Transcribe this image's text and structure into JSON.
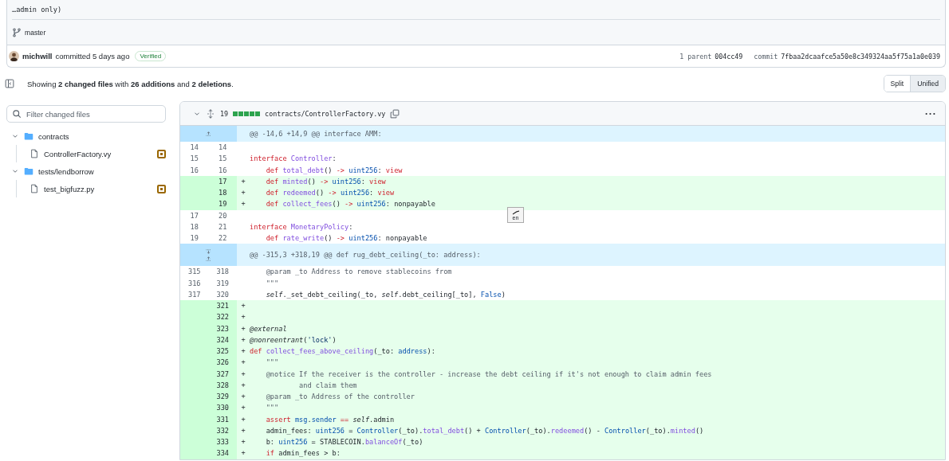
{
  "commit": {
    "message_tail": "…admin only)",
    "branch": "master",
    "author": "michwill",
    "action": "committed 5 days ago",
    "badge": "Verified",
    "parent_label": "1 parent",
    "parent": "004cc49",
    "commit_label": "commit",
    "hash": "7fbaa2dcaafce5a50e8c349324aa5f75a1a0e039"
  },
  "summary": {
    "text": "Showing **2 changed files** with **26 additions** and **2 deletions**."
  },
  "view_toggle": [
    {
      "label": "Split",
      "selected": false
    },
    {
      "label": "Unified",
      "selected": true
    }
  ],
  "filter": {
    "placeholder": "Filter changed files"
  },
  "tree": [
    {
      "name": "contracts",
      "expanded": true,
      "children": [
        {
          "name": "ControllerFactory.vy",
          "color": "#9a6700"
        }
      ]
    },
    {
      "name": "tests/lendborrow",
      "expanded": true,
      "children": [
        {
          "name": "test_bigfuzz.py",
          "color": "#9a6700"
        }
      ]
    }
  ],
  "file": {
    "expanded": true,
    "count": "19",
    "diffstat": {
      "level": 1
    },
    "path": "contracts/ControllerFactory.vy",
    "rows": [
      {
        "kind": "hunk",
        "expand_up": true,
        "expand_down": false,
        "text": "@@ -14,6 +14,9 @@ interface AMM:"
      },
      {
        "kind": "context",
        "old": "14",
        "new": "14",
        "code": []
      },
      {
        "kind": "context",
        "old": "15",
        "new": "15",
        "code": [
          {
            "kind": "kw",
            "t": "interface "
          },
          {
            "kind": "fn",
            "t": "Controller"
          },
          {
            "kind": "p",
            "t": ":"
          }
        ]
      },
      {
        "kind": "context",
        "old": "16",
        "new": "16",
        "code": [
          {
            "kind": "kw",
            "t": "    def "
          },
          {
            "kind": "fn",
            "t": "total_debt"
          },
          {
            "kind": "p",
            "t": "() "
          },
          {
            "kind": "kw",
            "t": "-> "
          },
          {
            "kind": "ty",
            "t": "uint256"
          },
          {
            "kind": "p",
            "t": ": "
          },
          {
            "kind": "kw",
            "t": "view"
          }
        ]
      },
      {
        "kind": "add",
        "new": "17",
        "sign": "+",
        "code": [
          {
            "kind": "kw",
            "t": "    def "
          },
          {
            "kind": "fn",
            "t": "minted"
          },
          {
            "kind": "p",
            "t": "() "
          },
          {
            "kind": "kw",
            "t": "-> "
          },
          {
            "kind": "ty",
            "t": "uint256"
          },
          {
            "kind": "p",
            "t": ": "
          },
          {
            "kind": "kw",
            "t": "view"
          }
        ]
      },
      {
        "kind": "add",
        "new": "18",
        "sign": "+",
        "code": [
          {
            "kind": "kw",
            "t": "    def "
          },
          {
            "kind": "fn",
            "t": "redeemed"
          },
          {
            "kind": "p",
            "t": "() "
          },
          {
            "kind": "kw",
            "t": "-> "
          },
          {
            "kind": "ty",
            "t": "uint256"
          },
          {
            "kind": "p",
            "t": ": "
          },
          {
            "kind": "kw",
            "t": "view"
          }
        ]
      },
      {
        "kind": "add",
        "new": "19",
        "sign": "+",
        "code": [
          {
            "kind": "kw",
            "t": "    def "
          },
          {
            "kind": "fn",
            "t": "collect_fees"
          },
          {
            "kind": "p",
            "t": "() "
          },
          {
            "kind": "kw",
            "t": "-> "
          },
          {
            "kind": "ty",
            "t": "uint256"
          },
          {
            "kind": "p",
            "t": ": nonpayable"
          }
        ]
      },
      {
        "kind": "context",
        "old": "17",
        "new": "20",
        "code": []
      },
      {
        "kind": "context",
        "old": "18",
        "new": "21",
        "code": [
          {
            "kind": "kw",
            "t": "interface "
          },
          {
            "kind": "fn",
            "t": "MonetaryPolicy"
          },
          {
            "kind": "p",
            "t": ":"
          }
        ]
      },
      {
        "kind": "context",
        "old": "19",
        "new": "22",
        "code": [
          {
            "kind": "kw",
            "t": "    def "
          },
          {
            "kind": "fn",
            "t": "rate_write"
          },
          {
            "kind": "p",
            "t": "() "
          },
          {
            "kind": "kw",
            "t": "-> "
          },
          {
            "kind": "ty",
            "t": "uint256"
          },
          {
            "kind": "p",
            "t": ": nonpayable"
          }
        ]
      },
      {
        "kind": "hunk",
        "expand_up": true,
        "expand_down": true,
        "text": "@@ -315,3 +318,19 @@ def rug_debt_ceiling(_to: address):"
      },
      {
        "kind": "context",
        "old": "315",
        "new": "318",
        "code": [
          {
            "kind": "cm",
            "t": "    @param _to Address to remove stablecoins from"
          }
        ]
      },
      {
        "kind": "context",
        "old": "316",
        "new": "319",
        "code": [
          {
            "kind": "cm",
            "t": "    \"\"\""
          }
        ]
      },
      {
        "kind": "context",
        "old": "317",
        "new": "320",
        "code": [
          {
            "kind": "it",
            "t": "    self"
          },
          {
            "kind": "p",
            "t": "._set_debt_ceiling(_to, "
          },
          {
            "kind": "it",
            "t": "self"
          },
          {
            "kind": "p",
            "t": ".debt_ceiling[_to], "
          },
          {
            "kind": "ty",
            "t": "False"
          },
          {
            "kind": "p",
            "t": ")"
          }
        ]
      },
      {
        "kind": "add",
        "new": "321",
        "sign": "+",
        "code": []
      },
      {
        "kind": "add",
        "new": "322",
        "sign": "+",
        "code": []
      },
      {
        "kind": "add",
        "new": "323",
        "sign": "+",
        "code": [
          {
            "kind": "it",
            "t": "@external"
          }
        ]
      },
      {
        "kind": "add",
        "new": "324",
        "sign": "+",
        "code": [
          {
            "kind": "it",
            "t": "@nonreentrant"
          },
          {
            "kind": "p",
            "t": "("
          },
          {
            "kind": "st",
            "t": "'lock'"
          },
          {
            "kind": "p",
            "t": ")"
          }
        ]
      },
      {
        "kind": "add",
        "new": "325",
        "sign": "+",
        "code": [
          {
            "kind": "kw",
            "t": "def "
          },
          {
            "kind": "fn",
            "t": "collect_fees_above_ceiling"
          },
          {
            "kind": "p",
            "t": "(_to: "
          },
          {
            "kind": "ty",
            "t": "address"
          },
          {
            "kind": "p",
            "t": "):"
          }
        ]
      },
      {
        "kind": "add",
        "new": "326",
        "sign": "+",
        "code": [
          {
            "kind": "cm",
            "t": "    \"\"\""
          }
        ]
      },
      {
        "kind": "add",
        "new": "327",
        "sign": "+",
        "code": [
          {
            "kind": "cm",
            "t": "    @notice If the receiver is the controller - increase the debt ceiling if it's not enough to claim admin fees"
          }
        ]
      },
      {
        "kind": "add",
        "new": "328",
        "sign": "+",
        "code": [
          {
            "kind": "cm",
            "t": "            and claim them"
          }
        ]
      },
      {
        "kind": "add",
        "new": "329",
        "sign": "+",
        "code": [
          {
            "kind": "cm",
            "t": "    @param _to Address of the controller"
          }
        ]
      },
      {
        "kind": "add",
        "new": "330",
        "sign": "+",
        "code": [
          {
            "kind": "cm",
            "t": "    \"\"\""
          }
        ]
      },
      {
        "kind": "add",
        "new": "331",
        "sign": "+",
        "code": [
          {
            "kind": "kw",
            "t": "    assert "
          },
          {
            "kind": "ty",
            "t": "msg"
          },
          {
            "kind": "p",
            "t": "."
          },
          {
            "kind": "ty",
            "t": "sender "
          },
          {
            "kind": "kw",
            "t": "== "
          },
          {
            "kind": "it",
            "t": "self"
          },
          {
            "kind": "p",
            "t": ".admin"
          }
        ]
      },
      {
        "kind": "add",
        "new": "332",
        "sign": "+",
        "code": [
          {
            "kind": "p",
            "t": "    admin_fees: "
          },
          {
            "kind": "ty",
            "t": "uint256"
          },
          {
            "kind": "p",
            "t": " = "
          },
          {
            "kind": "ty",
            "t": "Controller"
          },
          {
            "kind": "p",
            "t": "(_to)."
          },
          {
            "kind": "fn",
            "t": "total_debt"
          },
          {
            "kind": "p",
            "t": "() + "
          },
          {
            "kind": "ty",
            "t": "Controller"
          },
          {
            "kind": "p",
            "t": "(_to)."
          },
          {
            "kind": "fn",
            "t": "redeemed"
          },
          {
            "kind": "p",
            "t": "() - "
          },
          {
            "kind": "ty",
            "t": "Controller"
          },
          {
            "kind": "p",
            "t": "(_to)."
          },
          {
            "kind": "fn",
            "t": "minted"
          },
          {
            "kind": "p",
            "t": "()"
          }
        ]
      },
      {
        "kind": "add",
        "new": "333",
        "sign": "+",
        "code": [
          {
            "kind": "p",
            "t": "    b: "
          },
          {
            "kind": "ty",
            "t": "uint256"
          },
          {
            "kind": "p",
            "t": " = STABLECOIN."
          },
          {
            "kind": "fn",
            "t": "balanceOf"
          },
          {
            "kind": "p",
            "t": "(_to)"
          }
        ]
      },
      {
        "kind": "add",
        "new": "334",
        "sign": "+",
        "code": [
          {
            "kind": "kw",
            "t": "    if "
          },
          {
            "kind": "p",
            "t": "admin_fees > b:"
          }
        ]
      }
    ]
  },
  "overlay": {
    "label": "en"
  }
}
